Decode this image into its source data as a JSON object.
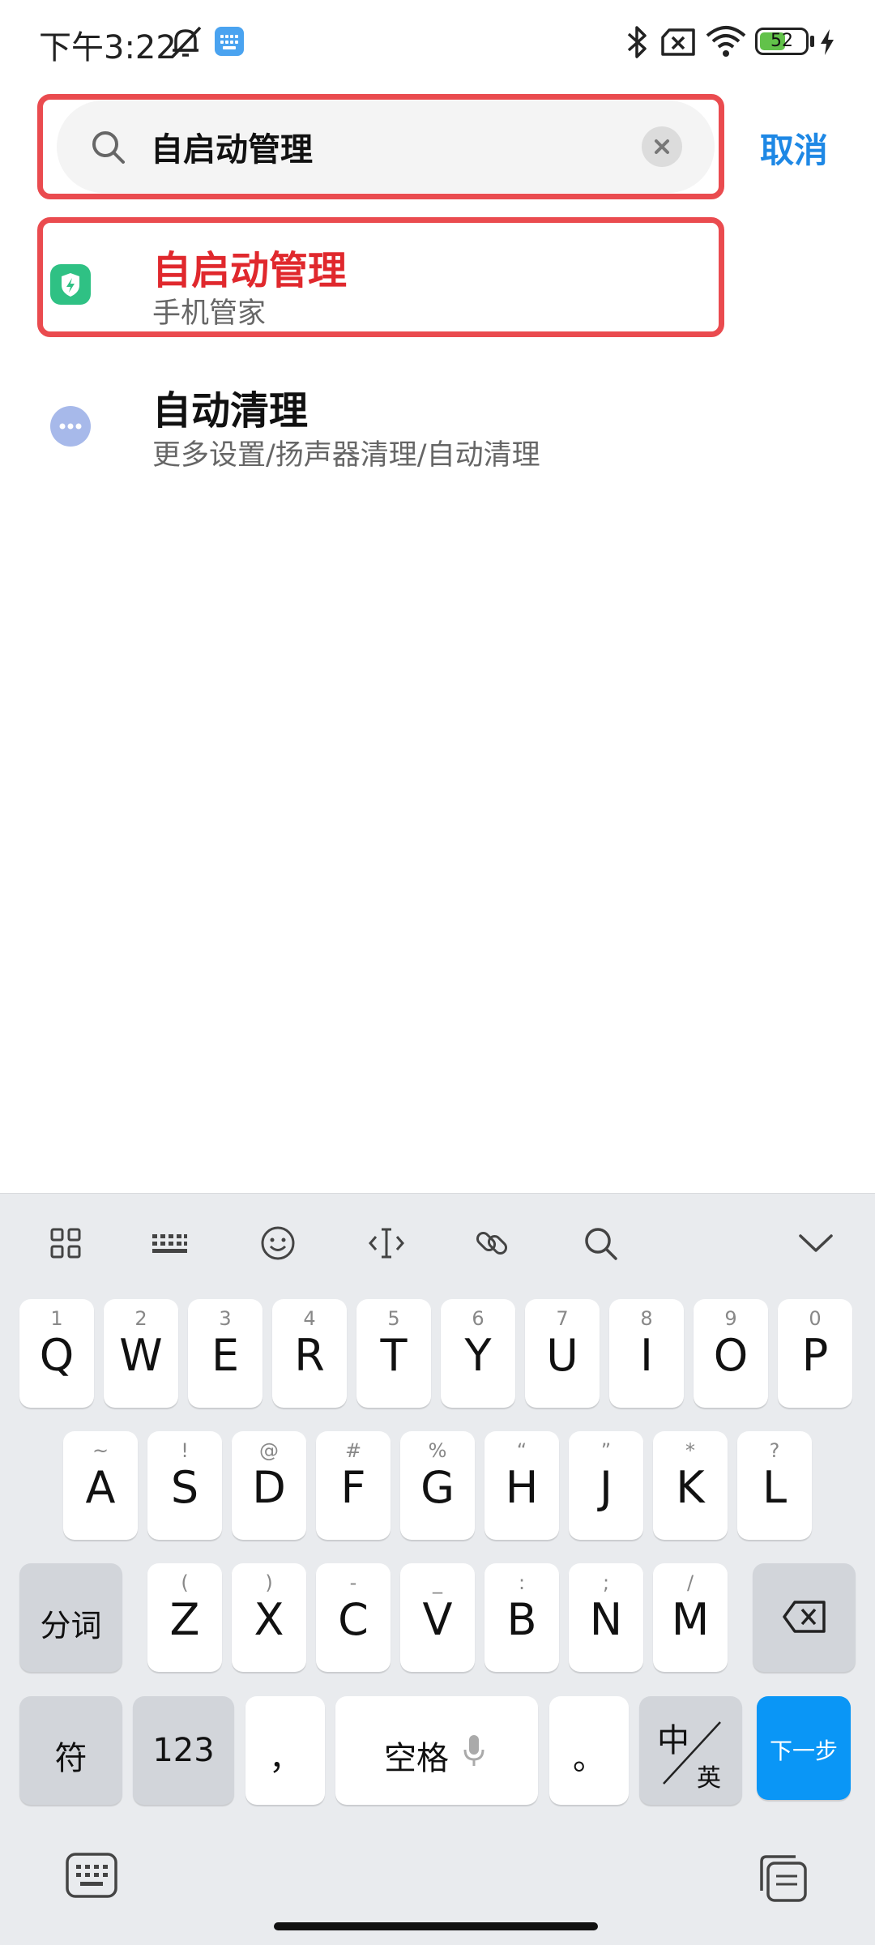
{
  "status_bar": {
    "time": "下午3:22",
    "battery_level": "52"
  },
  "search": {
    "query": "自启动管理",
    "cancel_label": "取消"
  },
  "results": [
    {
      "title": "自启动管理",
      "subtitle": "手机管家"
    },
    {
      "title": "自动清理",
      "subtitle": "更多设置/扬声器清理/自动清理"
    }
  ],
  "keyboard": {
    "row1": [
      {
        "key": "Q",
        "hint": "1"
      },
      {
        "key": "W",
        "hint": "2"
      },
      {
        "key": "E",
        "hint": "3"
      },
      {
        "key": "R",
        "hint": "4"
      },
      {
        "key": "T",
        "hint": "5"
      },
      {
        "key": "Y",
        "hint": "6"
      },
      {
        "key": "U",
        "hint": "7"
      },
      {
        "key": "I",
        "hint": "8"
      },
      {
        "key": "O",
        "hint": "9"
      },
      {
        "key": "P",
        "hint": "0"
      }
    ],
    "row2": [
      {
        "key": "A",
        "hint": "~"
      },
      {
        "key": "S",
        "hint": "!"
      },
      {
        "key": "D",
        "hint": "@"
      },
      {
        "key": "F",
        "hint": "#"
      },
      {
        "key": "G",
        "hint": "%"
      },
      {
        "key": "H",
        "hint": "“"
      },
      {
        "key": "J",
        "hint": "”"
      },
      {
        "key": "K",
        "hint": "*"
      },
      {
        "key": "L",
        "hint": "?"
      }
    ],
    "row3": [
      {
        "key": "Z",
        "hint": "("
      },
      {
        "key": "X",
        "hint": ")"
      },
      {
        "key": "C",
        "hint": "-"
      },
      {
        "key": "V",
        "hint": "_"
      },
      {
        "key": "B",
        "hint": ":"
      },
      {
        "key": "N",
        "hint": ";"
      },
      {
        "key": "M",
        "hint": "/"
      }
    ],
    "segment_label": "分词",
    "symbol_label": "符",
    "numbers_label": "123",
    "comma_label": "，",
    "space_label": "空格",
    "period_label": "。",
    "lang_zh": "中",
    "lang_en": "英",
    "next_label": "下一步"
  }
}
